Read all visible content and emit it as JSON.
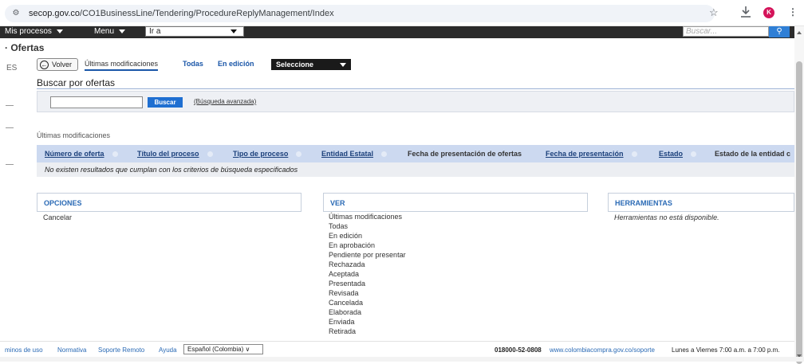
{
  "browser": {
    "url_host": "secop.gov.co",
    "url_path": "/CO1BusinessLine/Tendering/ProcedureReplyManagement/Index",
    "avatar_letter": "K"
  },
  "nav": {
    "mis_procesos": "Mis procesos",
    "menu": "Menu",
    "ir_a": "Ir a",
    "search_placeholder": "Buscar..."
  },
  "page": {
    "title": "Ofertas",
    "left_lang": "ES"
  },
  "tabs": {
    "volver": "Volver",
    "ultimas": "Últimas modificaciones",
    "todas": "Todas",
    "en_edicion": "En edición",
    "select_value": "Seleccione"
  },
  "search": {
    "title": "Buscar por ofertas",
    "button": "Buscar",
    "advanced": "(Búsqueda avanzada)"
  },
  "results": {
    "section_label": "Últimas modificaciones",
    "columns": [
      "Número de oferta",
      "Título del proceso",
      "Tipo de proceso",
      "Entidad Estatal",
      "Fecha de presentación de ofertas",
      "Fecha de presentación",
      "Estado",
      "Estado de la entidad c"
    ],
    "empty_message": "No existen resultados que cumplan con los criterios de búsqueda especificados"
  },
  "opciones": {
    "header": "OPCIONES",
    "items": [
      "Cancelar"
    ]
  },
  "ver": {
    "header": "VER",
    "items": [
      "Últimas modificaciones",
      "Todas",
      "En edición",
      "En aprobación",
      "Pendiente por presentar",
      "Rechazada",
      "Aceptada",
      "Presentada",
      "Revisada",
      "Cancelada",
      "Elaborada",
      "Enviada",
      "Retirada"
    ]
  },
  "herramientas": {
    "header": "HERRAMIENTAS",
    "message": "Herramientas no está disponible."
  },
  "footer": {
    "terminos": "minos de uso",
    "normativa": "Normativa",
    "soporte": "Soporte Remoto",
    "ayuda": "Ayuda",
    "language": "Español (Colombia)",
    "phone": "018000-52-0808",
    "support_link": "www.colombiacompra.gov.co/soporte",
    "hours": "Lunes a Viernes 7:00 a.m. a 7:00 p.m."
  }
}
